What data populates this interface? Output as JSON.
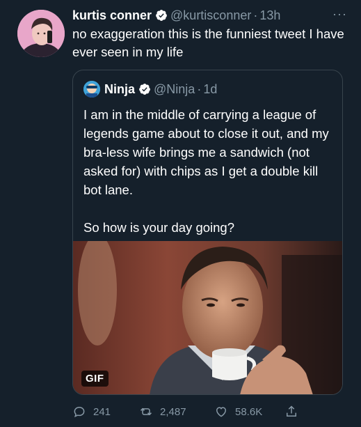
{
  "tweet": {
    "author_name": "kurtis conner",
    "author_handle": "@kurtisconner",
    "separator": "·",
    "time": "13h",
    "more_label": "···",
    "text": "no exaggeration this is the funniest tweet I have ever seen in my life",
    "avatar_icon": "profile-photo"
  },
  "quoted": {
    "author_name": "Ninja",
    "author_handle": "@Ninja",
    "separator": "·",
    "time": "1d",
    "text": "I am in the middle of carrying a league of legends game about to close it out, and my bra-less wife brings me a sandwich (not asked for) with chips as I get a double kill bot lane.",
    "text2": "So how is your day going?",
    "media_badge": "GIF",
    "media_icon": "gif-man-sipping-espresso"
  },
  "actions": {
    "replies": "241",
    "retweets": "2,487",
    "likes": "58.6K",
    "reply_icon": "reply-icon",
    "retweet_icon": "retweet-icon",
    "like_icon": "heart-icon",
    "share_icon": "share-icon"
  },
  "colors": {
    "background": "#15202b",
    "text": "#ffffff",
    "secondary": "#8899a6",
    "border": "#38444d",
    "verified": "#ffffff"
  }
}
